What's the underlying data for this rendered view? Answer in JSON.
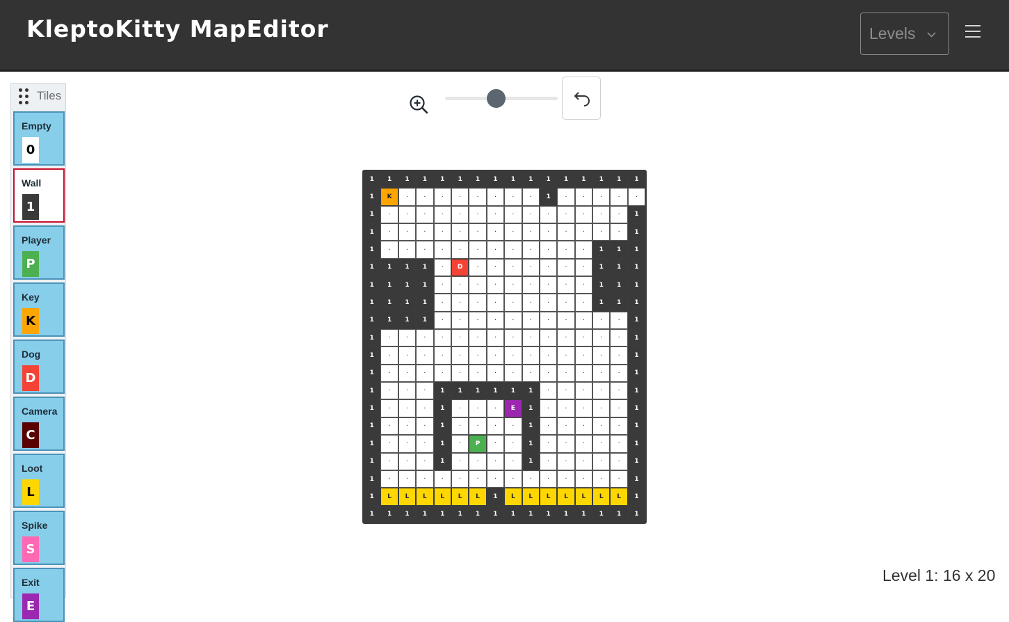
{
  "header": {
    "title": "KleptoKitty MapEditor",
    "levels_label": "Levels",
    "menu_icon": "hamburger-icon"
  },
  "sidebar": {
    "title": "Tiles",
    "items": [
      {
        "name": "Empty",
        "symbol": "0",
        "bg": "#ffffff",
        "fg": "#000000",
        "selected": false
      },
      {
        "name": "Wall",
        "symbol": "1",
        "bg": "#3a3a3a",
        "fg": "#ffffff",
        "selected": true
      },
      {
        "name": "Player",
        "symbol": "P",
        "bg": "#4caf50",
        "fg": "#ffffff",
        "selected": false
      },
      {
        "name": "Key",
        "symbol": "K",
        "bg": "#ffa500",
        "fg": "#000000",
        "selected": false
      },
      {
        "name": "Dog",
        "symbol": "D",
        "bg": "#f44336",
        "fg": "#ffffff",
        "selected": false
      },
      {
        "name": "Camera",
        "symbol": "C",
        "bg": "#5a0000",
        "fg": "#ffffff",
        "selected": false
      },
      {
        "name": "Loot",
        "symbol": "L",
        "bg": "#ffd700",
        "fg": "#000000",
        "selected": false
      },
      {
        "name": "Spike",
        "symbol": "S",
        "bg": "#ff69b4",
        "fg": "#ffffff",
        "selected": false
      },
      {
        "name": "Exit",
        "symbol": "E",
        "bg": "#9c27b0",
        "fg": "#ffffff",
        "selected": false
      }
    ]
  },
  "toolbar": {
    "zoom_icon": "zoom-in-icon",
    "zoom_level": 0.45,
    "undo_icon": "undo-icon"
  },
  "map": {
    "rows": [
      "1111111111111111",
      "1K000000001000001",
      "1000000000000001",
      "1000000000000001",
      "1000000000000111",
      "11110D0000000111",
      "1111000000000111",
      "1111000000000111",
      "1111000000000001",
      "1000000000000001",
      "1000000000000001",
      "1000000000000001",
      "1000111111000001",
      "10001000E1000001",
      "1000100001000001",
      "100010P001000001",
      "1000100001000001",
      "1000000000000001",
      "1LLLLLL1LLLLLLL1",
      "1111111111111111"
    ],
    "empty_glyph": "·"
  },
  "status": {
    "level_info": "Level 1: 16 x 20"
  }
}
